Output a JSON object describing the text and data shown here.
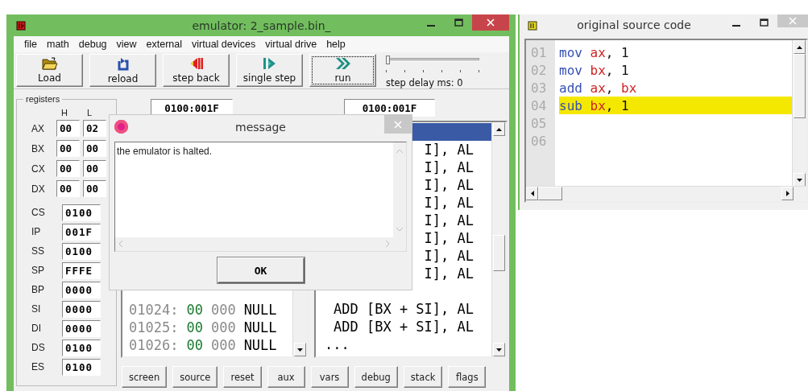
{
  "emulator": {
    "title": "emulator: 2_sample.bin_",
    "menu": [
      "file",
      "math",
      "debug",
      "view",
      "external",
      "virtual devices",
      "virtual drive",
      "help"
    ],
    "toolbar": [
      {
        "label": "Load",
        "kind": "load",
        "focused": false
      },
      {
        "label": "reload",
        "kind": "reload",
        "focused": false
      },
      {
        "label": "step back",
        "kind": "step-back",
        "focused": false
      },
      {
        "label": "single step",
        "kind": "single-step",
        "focused": false
      },
      {
        "label": "run",
        "kind": "run",
        "focused": true
      }
    ],
    "step_delay": {
      "label": "step delay ms: 0",
      "level": 0
    },
    "registers": {
      "title": "registers",
      "high_heading": "H",
      "low_heading": "L",
      "pairs": [
        {
          "name": "AX",
          "high": "00",
          "low": "02"
        },
        {
          "name": "BX",
          "high": "00",
          "low": "00"
        },
        {
          "name": "CX",
          "high": "00",
          "low": "00"
        },
        {
          "name": "DX",
          "high": "00",
          "low": "00"
        }
      ],
      "segments": [
        {
          "name": "CS",
          "value": "0100"
        },
        {
          "name": "IP",
          "value": "001F"
        },
        {
          "name": "SS",
          "value": "0100"
        },
        {
          "name": "SP",
          "value": "FFFE"
        },
        {
          "name": "BP",
          "value": "0000"
        },
        {
          "name": "SI",
          "value": "0000"
        },
        {
          "name": "DI",
          "value": "0000"
        },
        {
          "name": "DS",
          "value": "0100"
        },
        {
          "name": "ES",
          "value": "0100"
        }
      ]
    },
    "address_fields": [
      "0100:001F",
      "0100:001F"
    ],
    "memory_rows": [
      {
        "address": "01024:",
        "byte": "00",
        "decimal": "000",
        "char": "NULL"
      },
      {
        "address": "01025:",
        "byte": "00",
        "decimal": "000",
        "char": "NULL"
      },
      {
        "address": "01026:",
        "byte": "00",
        "decimal": "000",
        "char": "NULL"
      }
    ],
    "disassembly_rows": [
      {
        "kind": "instruction",
        "selected": true
      },
      {
        "kind": "instruction",
        "text": "I], AL",
        "selected": false
      },
      {
        "kind": "instruction",
        "text": "I], AL",
        "selected": false
      },
      {
        "kind": "instruction",
        "text": "I], AL",
        "selected": false
      },
      {
        "kind": "instruction",
        "text": "I], AL",
        "selected": false
      },
      {
        "kind": "instruction",
        "text": "I], AL",
        "selected": false
      },
      {
        "kind": "instruction",
        "text": "I], AL",
        "selected": false
      },
      {
        "kind": "instruction",
        "text": "I], AL",
        "selected": false
      },
      {
        "kind": "instruction",
        "text": "I], AL",
        "selected": false
      },
      {
        "kind": "instruction",
        "selected": false
      },
      {
        "kind": "instruction",
        "text": "ADD [BX + SI], AL",
        "selected": false
      },
      {
        "kind": "instruction",
        "text": "ADD [BX + SI], AL",
        "selected": false
      },
      {
        "kind": "ellipsis",
        "text": "...",
        "selected": false
      }
    ],
    "bottom_buttons": [
      "screen",
      "source",
      "reset",
      "aux",
      "vars",
      "debug",
      "stack",
      "flags"
    ]
  },
  "dialog": {
    "title": "message",
    "text": "the emulator is halted.",
    "button": "OK"
  },
  "source_window": {
    "title": "original source code",
    "lines": [
      {
        "number": "01",
        "selected": false,
        "tokens": [
          {
            "text": "mov",
            "kind": "keyword"
          },
          {
            "text": " ax",
            "kind": "register"
          },
          {
            "text": ", 1",
            "kind": "plain"
          }
        ]
      },
      {
        "number": "02",
        "selected": false,
        "tokens": [
          {
            "text": "mov",
            "kind": "keyword"
          },
          {
            "text": " bx",
            "kind": "register"
          },
          {
            "text": ", 1",
            "kind": "plain"
          }
        ]
      },
      {
        "number": "03",
        "selected": false,
        "tokens": [
          {
            "text": "add",
            "kind": "keyword"
          },
          {
            "text": " ax",
            "kind": "register"
          },
          {
            "text": ",",
            "kind": "plain"
          },
          {
            "text": " bx",
            "kind": "register"
          }
        ]
      },
      {
        "number": "04",
        "selected": true,
        "tokens": [
          {
            "text": "sub",
            "kind": "keyword"
          },
          {
            "text": " bx",
            "kind": "register"
          },
          {
            "text": ", 1",
            "kind": "plain"
          }
        ]
      },
      {
        "number": "05",
        "selected": false
      },
      {
        "number": "06",
        "selected": false
      }
    ]
  }
}
